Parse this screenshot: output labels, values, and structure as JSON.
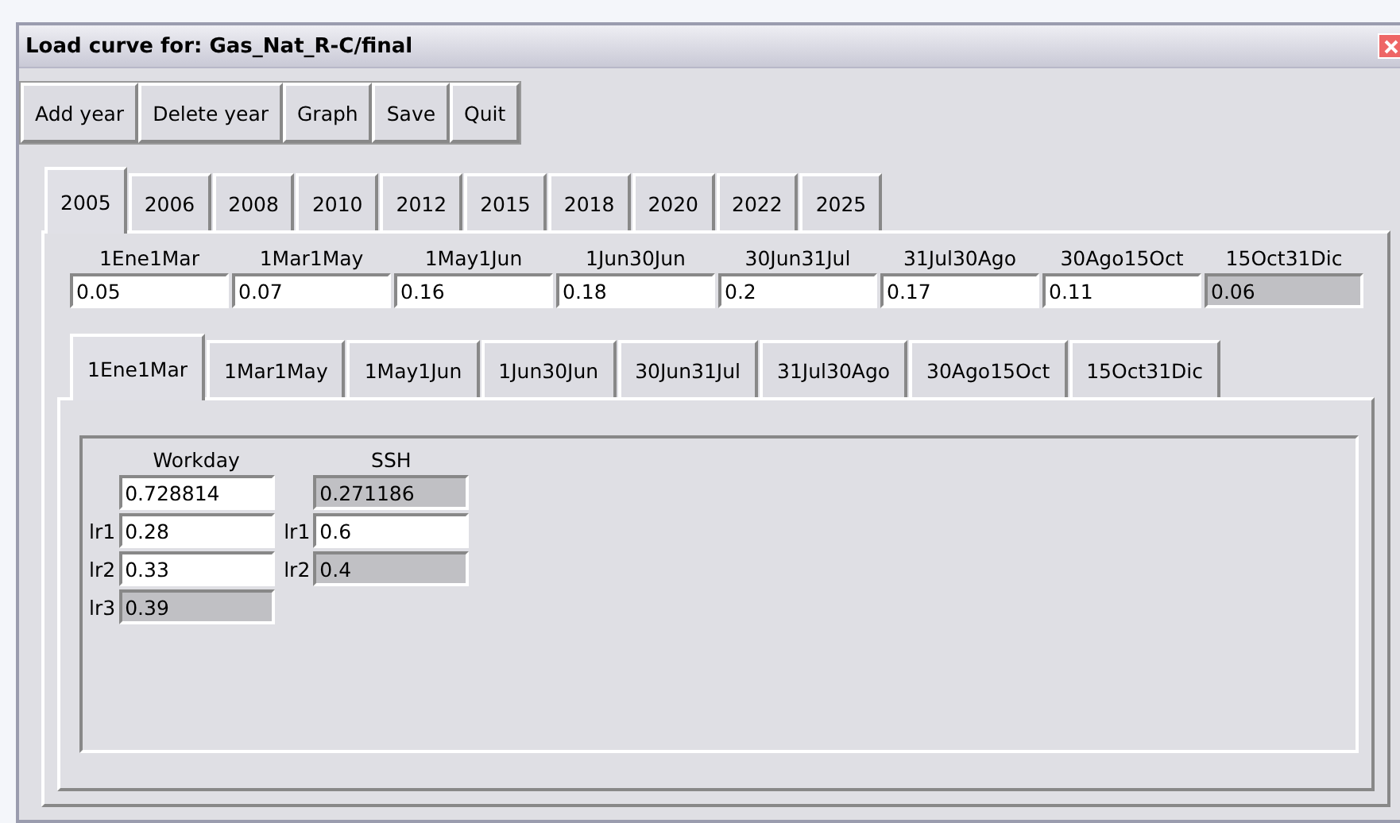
{
  "window": {
    "title": "Load curve for: Gas_Nat_R-C/final"
  },
  "toolbar": [
    "Add year",
    "Delete year",
    "Graph",
    "Save",
    "Quit"
  ],
  "year_tabs": [
    {
      "label": "2005",
      "selected": true
    },
    {
      "label": "2006",
      "selected": false
    },
    {
      "label": "2008",
      "selected": false
    },
    {
      "label": "2010",
      "selected": false
    },
    {
      "label": "2012",
      "selected": false
    },
    {
      "label": "2015",
      "selected": false
    },
    {
      "label": "2018",
      "selected": false
    },
    {
      "label": "2020",
      "selected": false
    },
    {
      "label": "2022",
      "selected": false
    },
    {
      "label": "2025",
      "selected": false
    }
  ],
  "periods": [
    {
      "label": "1Ene1Mar",
      "value": "0.05",
      "disabled": false
    },
    {
      "label": "1Mar1May",
      "value": "0.07",
      "disabled": false
    },
    {
      "label": "1May1Jun",
      "value": "0.16",
      "disabled": false
    },
    {
      "label": "1Jun30Jun",
      "value": "0.18",
      "disabled": false
    },
    {
      "label": "30Jun31Jul",
      "value": "0.2",
      "disabled": false
    },
    {
      "label": "31Jul30Ago",
      "value": "0.17",
      "disabled": false
    },
    {
      "label": "30Ago15Oct",
      "value": "0.11",
      "disabled": false
    },
    {
      "label": "15Oct31Dic",
      "value": "0.06",
      "disabled": true
    }
  ],
  "period_tabs": [
    {
      "label": "1Ene1Mar",
      "selected": true
    },
    {
      "label": "1Mar1May",
      "selected": false
    },
    {
      "label": "1May1Jun",
      "selected": false
    },
    {
      "label": "1Jun30Jun",
      "selected": false
    },
    {
      "label": "30Jun31Jul",
      "selected": false
    },
    {
      "label": "31Jul30Ago",
      "selected": false
    },
    {
      "label": "30Ago15Oct",
      "selected": false
    },
    {
      "label": "15Oct31Dic",
      "selected": false
    }
  ],
  "day_types": [
    {
      "label": "Workday",
      "value": "0.728814",
      "disabled": false,
      "rows": [
        {
          "label": "lr1",
          "value": "0.28",
          "disabled": false
        },
        {
          "label": "lr2",
          "value": "0.33",
          "disabled": false
        },
        {
          "label": "lr3",
          "value": "0.39",
          "disabled": true
        }
      ]
    },
    {
      "label": "SSH",
      "value": "0.271186",
      "disabled": true,
      "rows": [
        {
          "label": "lr1",
          "value": "0.6",
          "disabled": false
        },
        {
          "label": "lr2",
          "value": "0.4",
          "disabled": true
        }
      ]
    }
  ]
}
